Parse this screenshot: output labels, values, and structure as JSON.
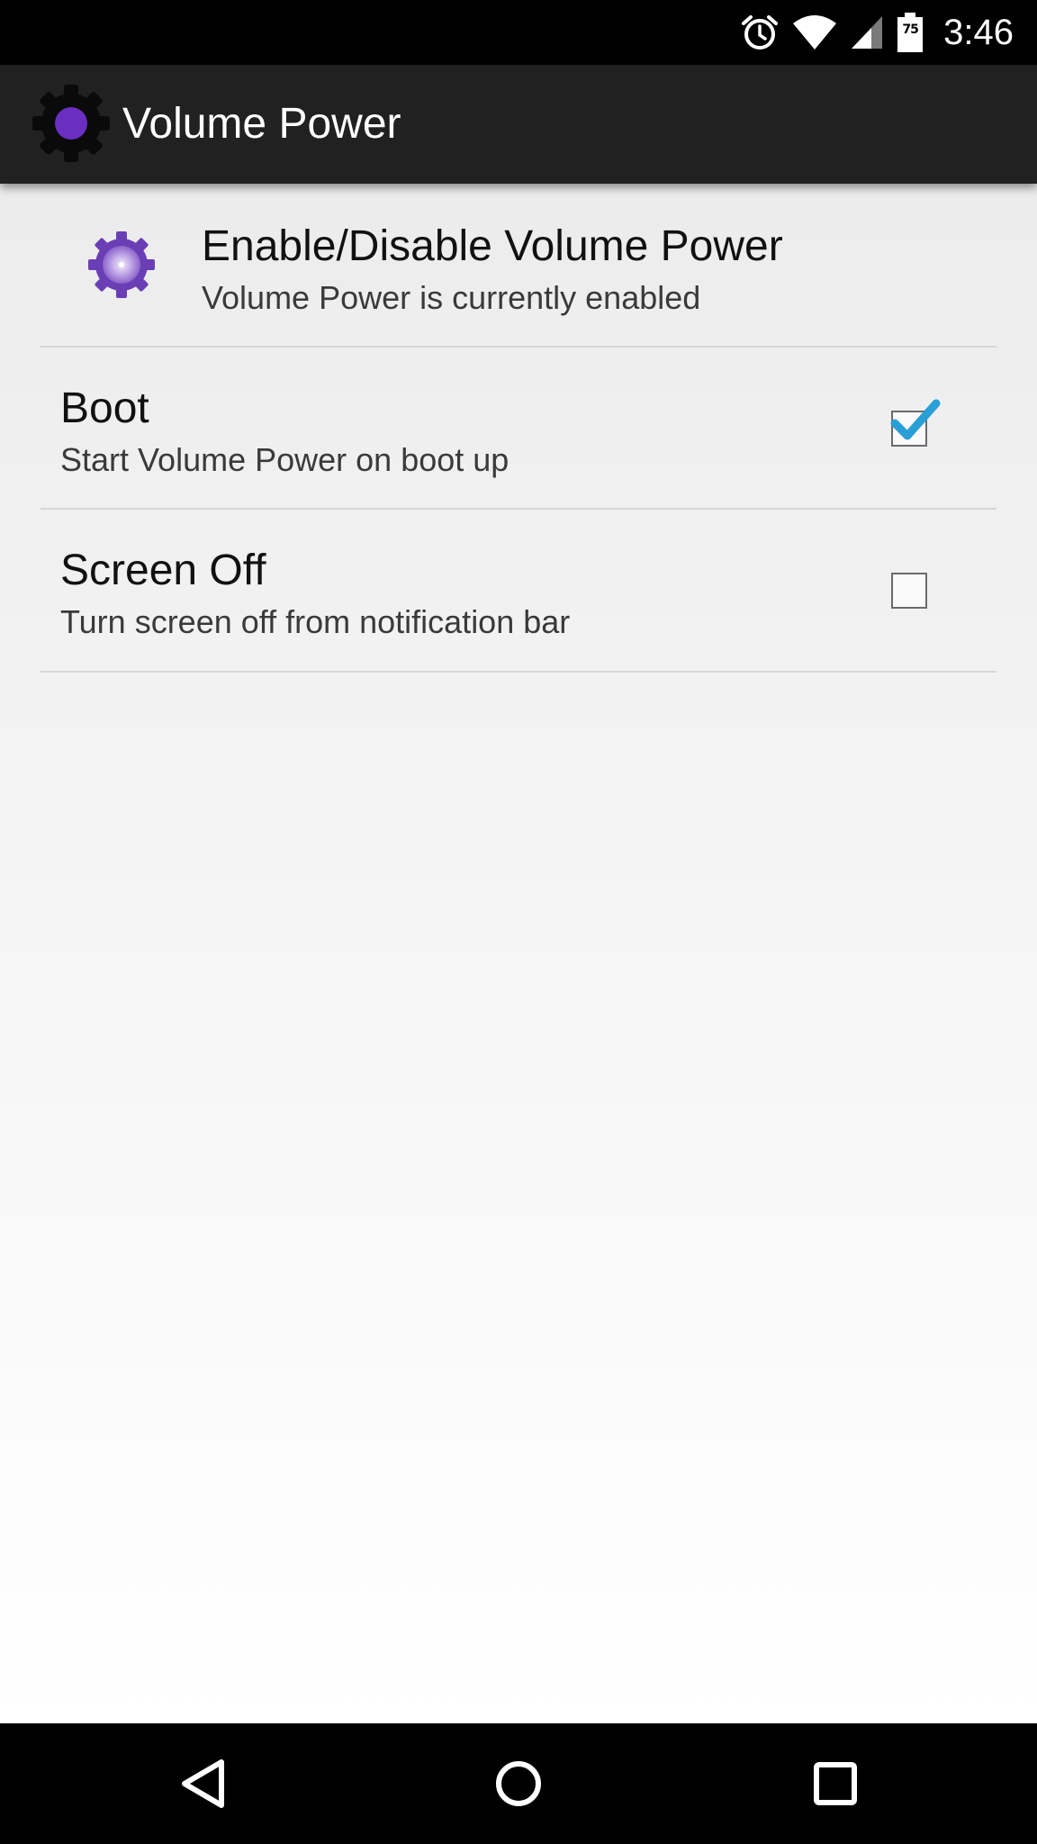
{
  "status_bar": {
    "time": "3:46",
    "battery_level": "75",
    "icons": [
      "alarm-icon",
      "wifi-icon",
      "cell-signal-icon",
      "battery-icon"
    ]
  },
  "action_bar": {
    "title": "Volume Power",
    "icon": "gear-icon"
  },
  "header_pref": {
    "title": "Enable/Disable Volume Power",
    "summary": "Volume Power is currently enabled",
    "icon": "gear-icon"
  },
  "preferences": [
    {
      "title": "Boot",
      "summary": "Start Volume Power on boot up",
      "checked": true
    },
    {
      "title": "Screen Off",
      "summary": "Turn screen off from notification bar",
      "checked": false
    }
  ],
  "nav_bar": {
    "buttons": [
      "back-icon",
      "home-icon",
      "recents-icon"
    ]
  },
  "colors": {
    "action_bar": "#212121",
    "accent_purple": "#6a3fb5",
    "check_blue": "#2a9fd6",
    "background": "#f0f0f0"
  }
}
